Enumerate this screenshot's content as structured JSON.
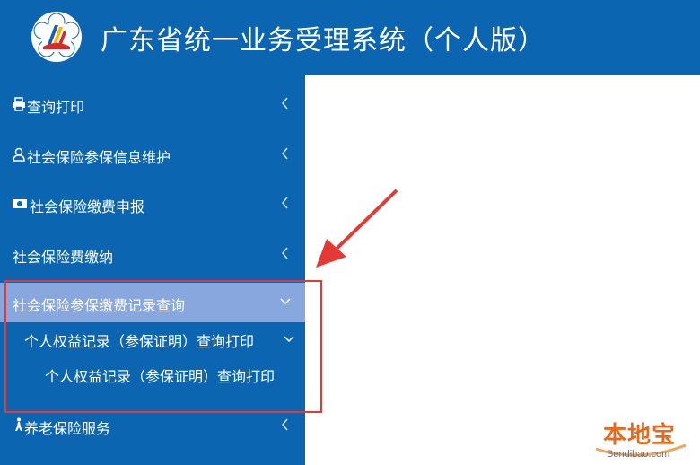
{
  "header": {
    "title": "广东省统一业务受理系统（个人版）"
  },
  "sidebar": {
    "items": [
      {
        "label": "查询打印",
        "icon": "printer-icon"
      },
      {
        "label": "社会保险参保信息维护",
        "icon": "user-icon"
      },
      {
        "label": "社会保险缴费申报",
        "icon": "money-icon"
      },
      {
        "label": "社会保险费缴纳",
        "icon": ""
      },
      {
        "label": "社会保险参保缴费记录查询",
        "icon": ""
      },
      {
        "label": "养老保险服务",
        "icon": "walking-person-icon"
      }
    ],
    "subitems": [
      {
        "label": "个人权益记录（参保证明）查询打印"
      },
      {
        "label": "个人权益记录（参保证明）查询打印"
      }
    ]
  },
  "watermark": {
    "brand": "本地宝",
    "url": "Bendibao.com"
  },
  "colors": {
    "header_bg": "#0b65b0",
    "active_item_bg": "#88a7de",
    "annotation_red": "#e53935",
    "watermark_orange": "#e36b1f"
  }
}
